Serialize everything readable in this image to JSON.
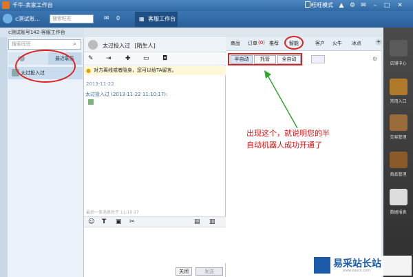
{
  "window": {
    "title": "千牛-卖家工作台",
    "mode_label": "旺旺模式"
  },
  "topnav": {
    "account": "c测试账...",
    "search_placeholder": "搜索旺旺",
    "msg_count": "0",
    "workbench_tab": "客服工作台"
  },
  "left": {
    "title": "c测试账号142-客服工作台",
    "search_placeholder": "搜索旺旺",
    "tab_contacts": "(1)",
    "tab_recent": "最近联系",
    "contact": "太过投入过"
  },
  "chat": {
    "name": "太过投入过",
    "tag": "[陌生人]",
    "notice": "对方离线或者隐身，您可以给TA留言。",
    "date": "2013-11-22",
    "sender_line": "太过投入过 (2013-11-22 11:10:17):",
    "last_msg": "最后一条消息时于 11:10:17",
    "close": "关闭",
    "send": "发送"
  },
  "right": {
    "tabs": [
      "商品",
      "订单",
      "推荐",
      "智能",
      "客户",
      "火牛",
      "冰点"
    ],
    "order_badge": "(0)",
    "modes": [
      "半自动",
      "托管",
      "全自动"
    ],
    "annotation_line1": "出现这个，就说明您的半",
    "annotation_line2": "自动机器人成功开通了"
  },
  "sidebar": {
    "items": [
      "店铺中心",
      "常用入口",
      "交易管理",
      "商品管理",
      "数据报表"
    ]
  },
  "watermark": {
    "brand": "易采站长站",
    "url": "www.easck.com"
  }
}
